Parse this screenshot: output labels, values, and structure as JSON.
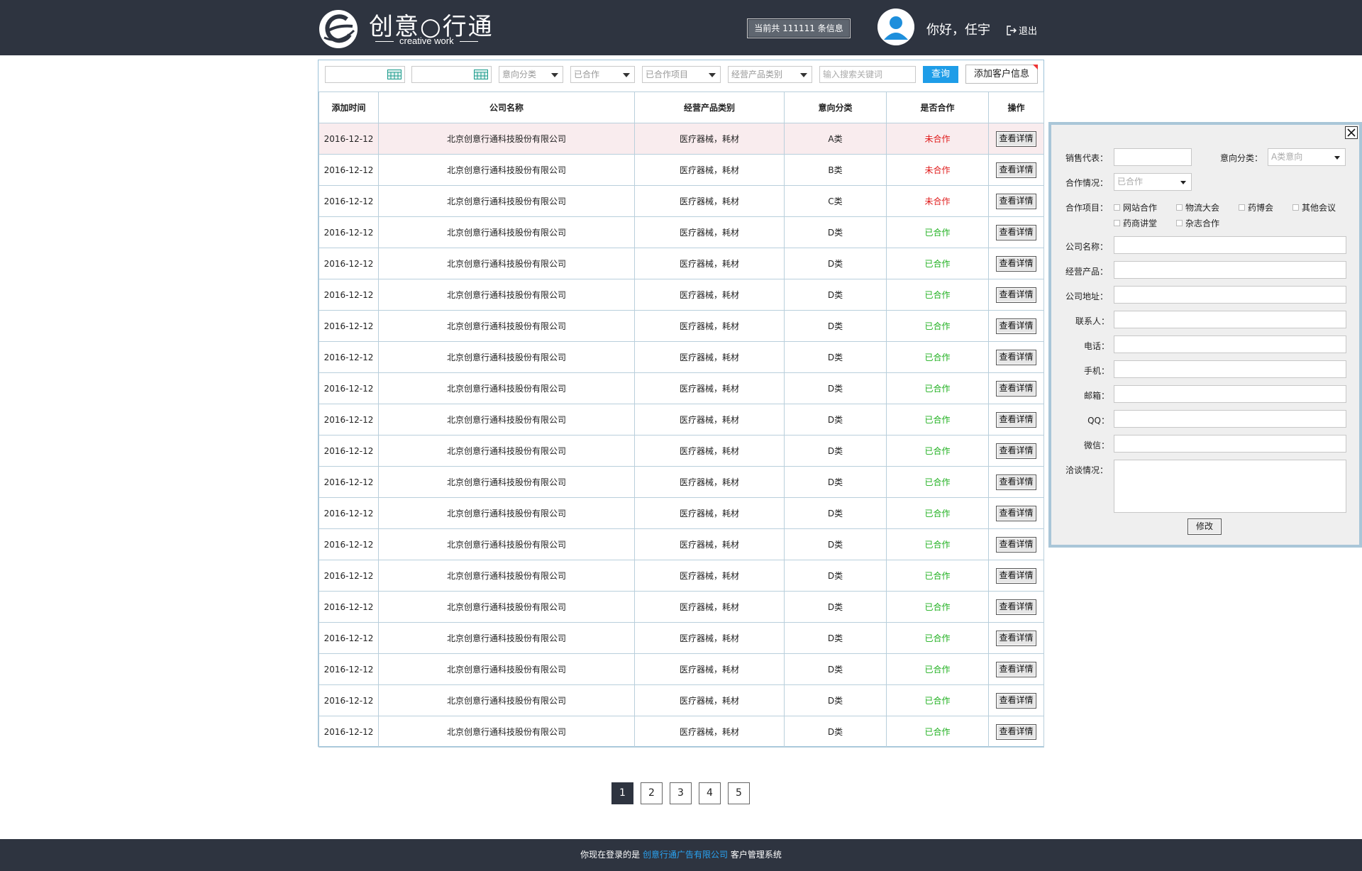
{
  "header": {
    "logo_cn": "创意○行通",
    "logo_en": "creative work",
    "count_badge": "当前共 111111 条信息",
    "greeting": "你好，任宇",
    "logout": "退出"
  },
  "toolbar": {
    "intent_placeholder": "意向分类",
    "coop_status": "已合作",
    "coop_project": "已合作项目",
    "product_category": "经营产品类别",
    "search_placeholder": "输入搜索关键词",
    "query_label": "查询",
    "add_label": "添加客户信息"
  },
  "table": {
    "headers": [
      "添加时间",
      "公司名称",
      "经营产品类别",
      "意向分类",
      "是否合作",
      "操作"
    ],
    "action_label": "查看详情",
    "rows": [
      {
        "date": "2016-12-12",
        "company": "北京创意行通科技股份有限公司",
        "product": "医疗器械，耗材",
        "intent": "A类",
        "status": "未合作"
      },
      {
        "date": "2016-12-12",
        "company": "北京创意行通科技股份有限公司",
        "product": "医疗器械，耗材",
        "intent": "B类",
        "status": "未合作"
      },
      {
        "date": "2016-12-12",
        "company": "北京创意行通科技股份有限公司",
        "product": "医疗器械，耗材",
        "intent": "C类",
        "status": "未合作"
      },
      {
        "date": "2016-12-12",
        "company": "北京创意行通科技股份有限公司",
        "product": "医疗器械，耗材",
        "intent": "D类",
        "status": "已合作"
      },
      {
        "date": "2016-12-12",
        "company": "北京创意行通科技股份有限公司",
        "product": "医疗器械，耗材",
        "intent": "D类",
        "status": "已合作"
      },
      {
        "date": "2016-12-12",
        "company": "北京创意行通科技股份有限公司",
        "product": "医疗器械，耗材",
        "intent": "D类",
        "status": "已合作"
      },
      {
        "date": "2016-12-12",
        "company": "北京创意行通科技股份有限公司",
        "product": "医疗器械，耗材",
        "intent": "D类",
        "status": "已合作"
      },
      {
        "date": "2016-12-12",
        "company": "北京创意行通科技股份有限公司",
        "product": "医疗器械，耗材",
        "intent": "D类",
        "status": "已合作"
      },
      {
        "date": "2016-12-12",
        "company": "北京创意行通科技股份有限公司",
        "product": "医疗器械，耗材",
        "intent": "D类",
        "status": "已合作"
      },
      {
        "date": "2016-12-12",
        "company": "北京创意行通科技股份有限公司",
        "product": "医疗器械，耗材",
        "intent": "D类",
        "status": "已合作"
      },
      {
        "date": "2016-12-12",
        "company": "北京创意行通科技股份有限公司",
        "product": "医疗器械，耗材",
        "intent": "D类",
        "status": "已合作"
      },
      {
        "date": "2016-12-12",
        "company": "北京创意行通科技股份有限公司",
        "product": "医疗器械，耗材",
        "intent": "D类",
        "status": "已合作"
      },
      {
        "date": "2016-12-12",
        "company": "北京创意行通科技股份有限公司",
        "product": "医疗器械，耗材",
        "intent": "D类",
        "status": "已合作"
      },
      {
        "date": "2016-12-12",
        "company": "北京创意行通科技股份有限公司",
        "product": "医疗器械，耗材",
        "intent": "D类",
        "status": "已合作"
      },
      {
        "date": "2016-12-12",
        "company": "北京创意行通科技股份有限公司",
        "product": "医疗器械，耗材",
        "intent": "D类",
        "status": "已合作"
      },
      {
        "date": "2016-12-12",
        "company": "北京创意行通科技股份有限公司",
        "product": "医疗器械，耗材",
        "intent": "D类",
        "status": "已合作"
      },
      {
        "date": "2016-12-12",
        "company": "北京创意行通科技股份有限公司",
        "product": "医疗器械，耗材",
        "intent": "D类",
        "status": "已合作"
      },
      {
        "date": "2016-12-12",
        "company": "北京创意行通科技股份有限公司",
        "product": "医疗器械，耗材",
        "intent": "D类",
        "status": "已合作"
      },
      {
        "date": "2016-12-12",
        "company": "北京创意行通科技股份有限公司",
        "product": "医疗器械，耗材",
        "intent": "D类",
        "status": "已合作"
      },
      {
        "date": "2016-12-12",
        "company": "北京创意行通科技股份有限公司",
        "product": "医疗器械，耗材",
        "intent": "D类",
        "status": "已合作"
      }
    ]
  },
  "pager": {
    "pages": [
      "1",
      "2",
      "3",
      "4",
      "5"
    ],
    "current": "1"
  },
  "footer": {
    "prefix": "你现在登录的是",
    "company": "创意行通广告有限公司",
    "suffix": "客户管理系统"
  },
  "side_form": {
    "sales_rep_label": "销售代表：",
    "intent_label": "意向分类：",
    "intent_value": "A类意向",
    "coop_label": "合作情况：",
    "coop_value": "已合作",
    "project_label": "合作项目：",
    "projects": [
      "网站合作",
      "物流大会",
      "药博会",
      "其他会议",
      "药商讲堂",
      "杂志合作"
    ],
    "company_label": "公司名称：",
    "product_label": "经营产品：",
    "address_label": "公司地址：",
    "contact_label": "联系人：",
    "phone_label": "电话：",
    "mobile_label": "手机：",
    "email_label": "邮箱：",
    "qq_label": "QQ：",
    "wechat_label": "微信：",
    "notes_label": "洽谈情况：",
    "modify_label": "修改"
  },
  "colors": {
    "header_bg": "#2e3440",
    "query_button": "#1e9de8",
    "not_cooperated": "#e01b1b",
    "cooperated": "#1fb01f",
    "footer_company": "#29a3f2"
  }
}
